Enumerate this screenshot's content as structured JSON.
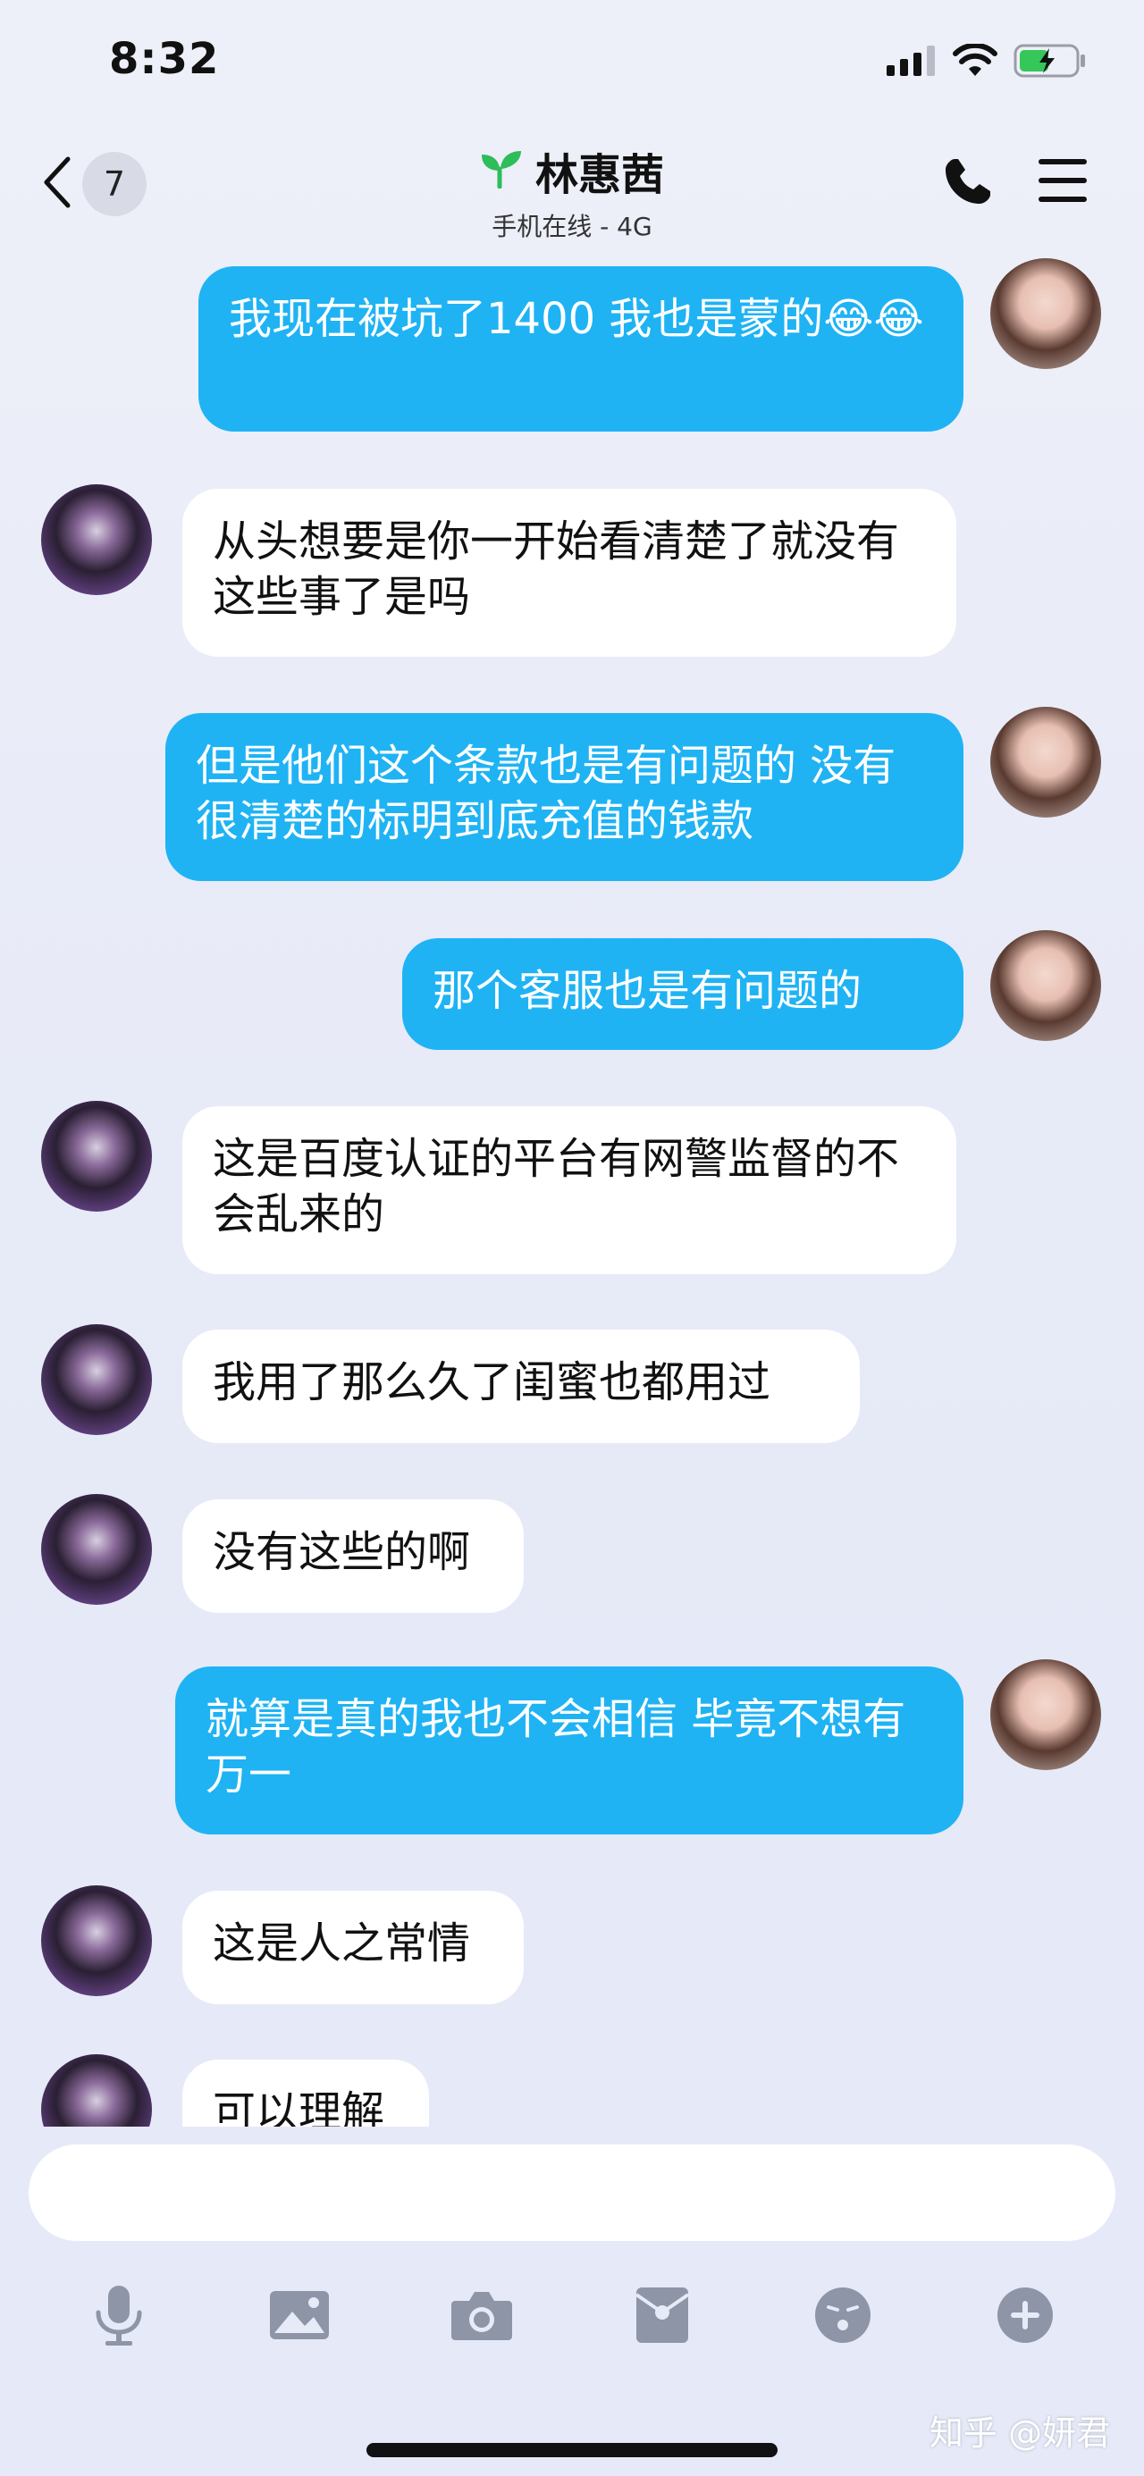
{
  "status_bar": {
    "time": "8:32"
  },
  "header": {
    "unread_count": "7",
    "contact_name": "林惠茜",
    "contact_status": "手机在线 - 4G"
  },
  "messages": [
    {
      "side": "sent",
      "text": "我现在被坑了1400 我也是蒙的😂😂"
    },
    {
      "side": "received",
      "text": "从头想要是你一开始看清楚了就没有这些事了是吗"
    },
    {
      "side": "sent",
      "text": "但是他们这个条款也是有问题的  没有很清楚的标明到底充值的钱款"
    },
    {
      "side": "sent",
      "text": "那个客服也是有问题的"
    },
    {
      "side": "received",
      "text": "这是百度认证的平台有网警监督的不会乱来的"
    },
    {
      "side": "received",
      "text": "我用了那么久了闺蜜也都用过"
    },
    {
      "side": "received",
      "text": "没有这些的啊"
    },
    {
      "side": "sent",
      "text": "就算是真的我也不会相信 毕竟不想有万一"
    },
    {
      "side": "received",
      "text": "这是人之常情"
    },
    {
      "side": "received",
      "text": "可以理解"
    }
  ],
  "input": {
    "value": ""
  },
  "icons": {
    "back": "chevron-left-icon",
    "online": "sprout-icon",
    "call": "phone-icon",
    "menu": "hamburger-menu-icon",
    "voice": "microphone-icon",
    "album": "image-icon",
    "camera": "camera-icon",
    "red_packet": "red-packet-icon",
    "emoji": "emoji-icon",
    "more": "plus-icon"
  },
  "colors": {
    "sent_bubble": "#1fb3f4",
    "received_bubble": "#ffffff",
    "background": "#e8ebf8",
    "online_icon": "#2dbd5a",
    "toolbar_icon": "#8e95a6"
  },
  "watermark": "知乎 @妍君"
}
